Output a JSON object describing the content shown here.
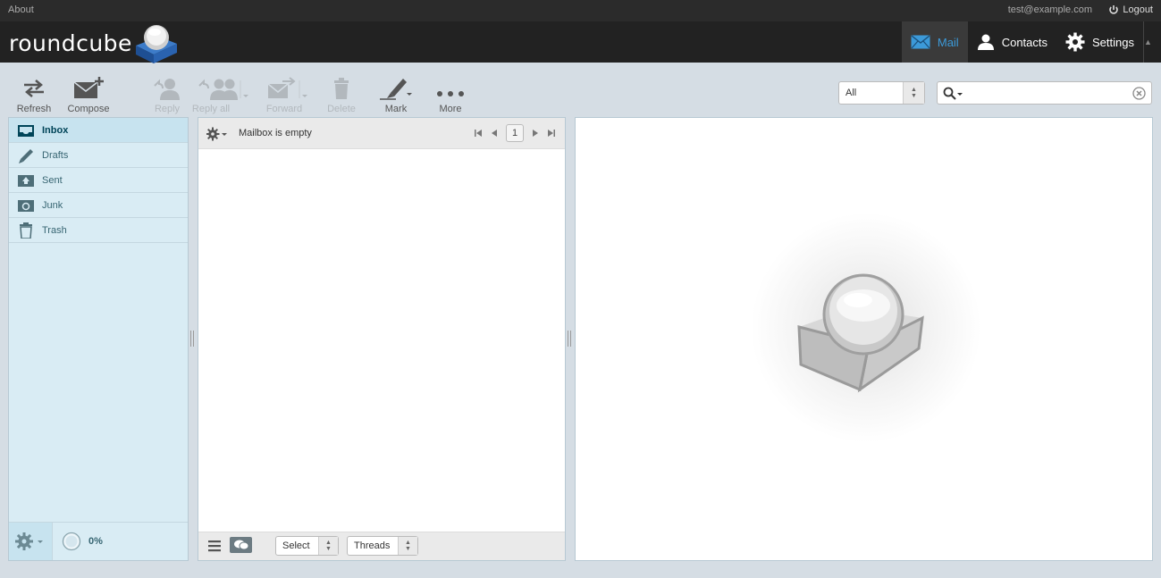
{
  "topline": {
    "about": "About",
    "user_email": "test@example.com",
    "logout": "Logout"
  },
  "header": {
    "logo_text": "roundcube",
    "tasks": [
      {
        "label": "Mail",
        "icon": "envelope-icon",
        "active": true
      },
      {
        "label": "Contacts",
        "icon": "person-icon",
        "active": false
      },
      {
        "label": "Settings",
        "icon": "gear-icon",
        "active": false
      }
    ]
  },
  "toolbar": {
    "refresh": "Refresh",
    "compose": "Compose",
    "reply": "Reply",
    "reply_all": "Reply all",
    "forward": "Forward",
    "delete": "Delete",
    "mark": "Mark",
    "more": "More",
    "filter_value": "All",
    "search_placeholder": ""
  },
  "folders": {
    "items": [
      {
        "label": "Inbox",
        "icon": "inbox-icon",
        "selected": true
      },
      {
        "label": "Drafts",
        "icon": "pencil-icon",
        "selected": false
      },
      {
        "label": "Sent",
        "icon": "sent-icon",
        "selected": false
      },
      {
        "label": "Junk",
        "icon": "junk-icon",
        "selected": false
      },
      {
        "label": "Trash",
        "icon": "trash-icon",
        "selected": false
      }
    ],
    "quota": "0%"
  },
  "message_list": {
    "status": "Mailbox is empty",
    "page": "1",
    "select_label": "Select",
    "threads_label": "Threads"
  },
  "colors": {
    "accent": "#3c9ad9",
    "header_bg": "#222222",
    "body_bg": "#d5dde4",
    "folder_bg": "#d9ecf4"
  }
}
